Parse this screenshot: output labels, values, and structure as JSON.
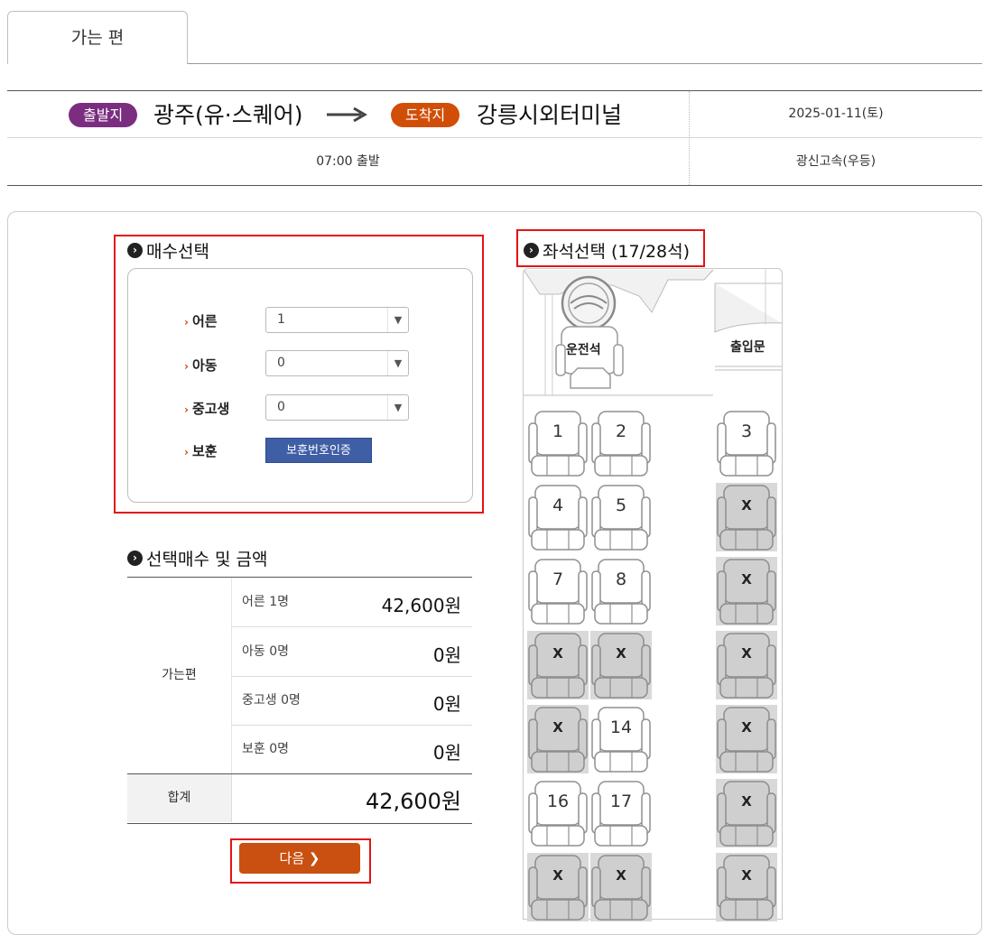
{
  "tab": {
    "label": "가는 편"
  },
  "route": {
    "departure_badge": "출발지",
    "departure_place": "광주(유·스퀘어)",
    "arrival_badge": "도착지",
    "arrival_place": "강릉시외터미널",
    "date": "2025-01-11(토)",
    "departure_time": "07:00 출발",
    "company": "광신고속(우등)"
  },
  "ticket_section": {
    "title": "매수선택",
    "rows": [
      {
        "label": "어른",
        "value": "1"
      },
      {
        "label": "아동",
        "value": "0"
      },
      {
        "label": "중고생",
        "value": "0"
      }
    ],
    "veteran_label": "보훈",
    "veteran_button": "보훈번호인증"
  },
  "price_section": {
    "title": "선택매수 및 금액",
    "group_label": "가는편",
    "rows": [
      {
        "label": "어른 1명",
        "amount": "42,600원"
      },
      {
        "label": "아동 0명",
        "amount": "0원"
      },
      {
        "label": "중고생 0명",
        "amount": "0원"
      },
      {
        "label": "보훈 0명",
        "amount": "0원"
      }
    ],
    "total_label": "합계",
    "total_amount": "42,600원",
    "next_button": "다음 ❯"
  },
  "seat_section": {
    "title": "좌석선택 (17/28석)",
    "driver_label": "운전석",
    "door_label": "출입문",
    "rows": [
      [
        {
          "label": "1",
          "status": "available"
        },
        {
          "label": "2",
          "status": "available"
        },
        {
          "label": "3",
          "status": "available"
        }
      ],
      [
        {
          "label": "4",
          "status": "available"
        },
        {
          "label": "5",
          "status": "available"
        },
        {
          "label": "X",
          "status": "sold"
        }
      ],
      [
        {
          "label": "7",
          "status": "available"
        },
        {
          "label": "8",
          "status": "available"
        },
        {
          "label": "X",
          "status": "sold"
        }
      ],
      [
        {
          "label": "X",
          "status": "sold"
        },
        {
          "label": "X",
          "status": "sold"
        },
        {
          "label": "X",
          "status": "sold"
        }
      ],
      [
        {
          "label": "X",
          "status": "sold"
        },
        {
          "label": "14",
          "status": "available"
        },
        {
          "label": "X",
          "status": "sold"
        }
      ],
      [
        {
          "label": "16",
          "status": "available"
        },
        {
          "label": "17",
          "status": "available"
        },
        {
          "label": "X",
          "status": "sold"
        }
      ],
      [
        {
          "label": "X",
          "status": "sold"
        },
        {
          "label": "X",
          "status": "sold"
        },
        {
          "label": "X",
          "status": "sold"
        }
      ]
    ]
  },
  "colors": {
    "departure_badge": "#7b2e7f",
    "arrival_badge": "#d14e08",
    "next_button": "#c95010",
    "veteran_button": "#3f5ea6",
    "highlight": "#e31414",
    "sold_seat": "#d9d9d9"
  }
}
